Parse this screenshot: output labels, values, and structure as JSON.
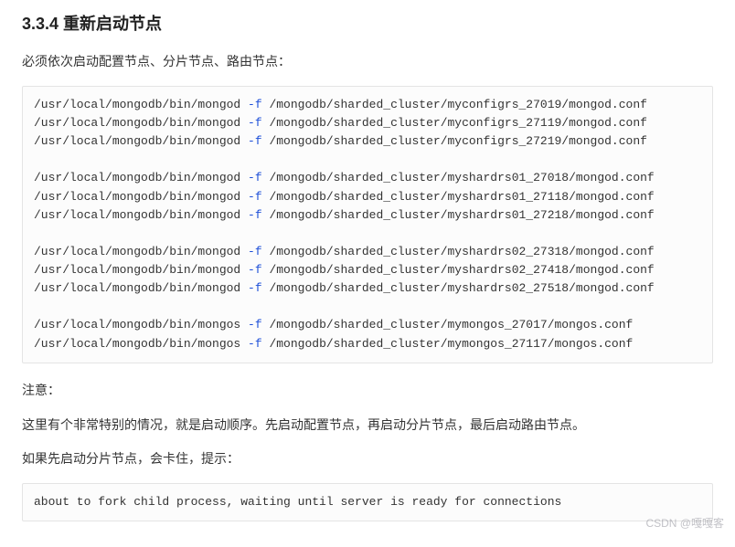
{
  "section": {
    "title": "3.3.4 重新启动节点",
    "intro": "必须依次启动配置节点、分片节点、路由节点：",
    "note_label": "注意：",
    "note_order": "这里有个非常特别的情况，就是启动顺序。先启动配置节点，再启动分片节点，最后启动路由节点。",
    "note_hang": "如果先启动分片节点，会卡住，提示："
  },
  "code1": {
    "flag": "-f",
    "lines": [
      {
        "cmd": "/usr/local/mongodb/bin/mongod ",
        "path": " /mongodb/sharded_cluster/myconfigrs_27019/mongod.conf"
      },
      {
        "cmd": "/usr/local/mongodb/bin/mongod ",
        "path": " /mongodb/sharded_cluster/myconfigrs_27119/mongod.conf"
      },
      {
        "cmd": "/usr/local/mongodb/bin/mongod ",
        "path": " /mongodb/sharded_cluster/myconfigrs_27219/mongod.conf"
      },
      {
        "blank": true
      },
      {
        "cmd": "/usr/local/mongodb/bin/mongod ",
        "path": " /mongodb/sharded_cluster/myshardrs01_27018/mongod.conf"
      },
      {
        "cmd": "/usr/local/mongodb/bin/mongod ",
        "path": " /mongodb/sharded_cluster/myshardrs01_27118/mongod.conf"
      },
      {
        "cmd": "/usr/local/mongodb/bin/mongod ",
        "path": " /mongodb/sharded_cluster/myshardrs01_27218/mongod.conf"
      },
      {
        "blank": true
      },
      {
        "cmd": "/usr/local/mongodb/bin/mongod ",
        "path": " /mongodb/sharded_cluster/myshardrs02_27318/mongod.conf"
      },
      {
        "cmd": "/usr/local/mongodb/bin/mongod ",
        "path": " /mongodb/sharded_cluster/myshardrs02_27418/mongod.conf"
      },
      {
        "cmd": "/usr/local/mongodb/bin/mongod ",
        "path": " /mongodb/sharded_cluster/myshardrs02_27518/mongod.conf"
      },
      {
        "blank": true
      },
      {
        "cmd": "/usr/local/mongodb/bin/mongos ",
        "path": " /mongodb/sharded_cluster/mymongos_27017/mongos.conf"
      },
      {
        "cmd": "/usr/local/mongodb/bin/mongos ",
        "path": " /mongodb/sharded_cluster/mymongos_27117/mongos.conf"
      }
    ]
  },
  "code2": {
    "text": "about to fork child process, waiting until server is ready for connections"
  },
  "watermark": "CSDN @嘎嘎客"
}
